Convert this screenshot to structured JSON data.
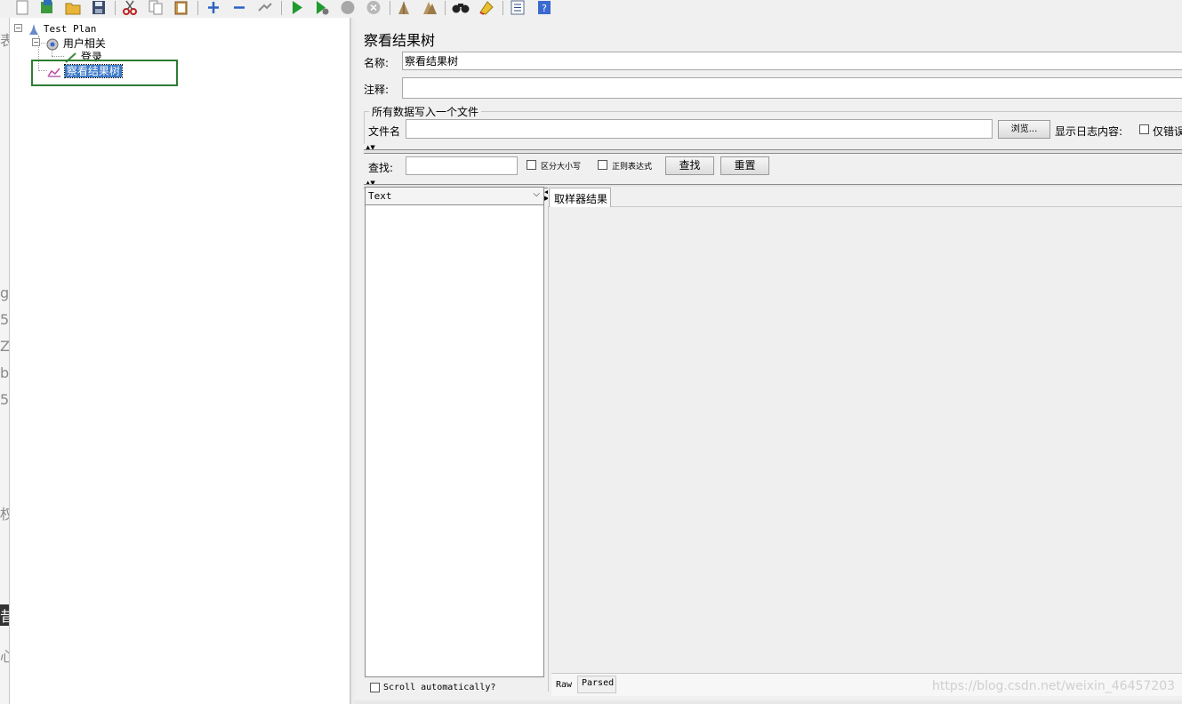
{
  "toolbar": {
    "icons": [
      "new-icon",
      "templates-icon",
      "open-icon",
      "save-icon",
      "cut-icon",
      "copy-icon",
      "paste-icon",
      "expand-icon",
      "collapse-icon",
      "toggle-icon",
      "start-icon",
      "start-no-pause-icon",
      "stop-icon",
      "shutdown-icon",
      "clear-icon",
      "clear-all-icon",
      "search-icon",
      "reset-search-icon",
      "function-helper-icon",
      "help-icon"
    ]
  },
  "tree": {
    "root": "Test Plan",
    "thread_group": "用户相关",
    "sampler": "登录",
    "listener": "察看结果树"
  },
  "panel": {
    "title": "察看结果树",
    "name_label": "名称:",
    "name_value": "察看结果树",
    "comment_label": "注释:",
    "comment_value": "",
    "file_section_title": "所有数据写入一个文件",
    "filename_label": "文件名",
    "filename_value": "",
    "browse_button": "浏览...",
    "log_content_label": "显示日志内容:",
    "errors_only_label": "仅错误"
  },
  "search": {
    "label": "查找:",
    "value": "",
    "case_sensitive_label": "区分大小写",
    "regex_label": "正则表达式",
    "find_button": "查找",
    "reset_button": "重置"
  },
  "results": {
    "renderer_selected": "Text",
    "scroll_auto_label": "Scroll automatically?",
    "tab_sampler_result": "取样器结果",
    "bottom_tab_raw": "Raw",
    "bottom_tab_parsed": "Parsed"
  },
  "watermark": "https://blog.csdn.net/weixin_46457203",
  "colors": {
    "selection": "#3a78c8",
    "highlight_box": "#2e7d32",
    "panel_bg": "#f0f0f0"
  }
}
